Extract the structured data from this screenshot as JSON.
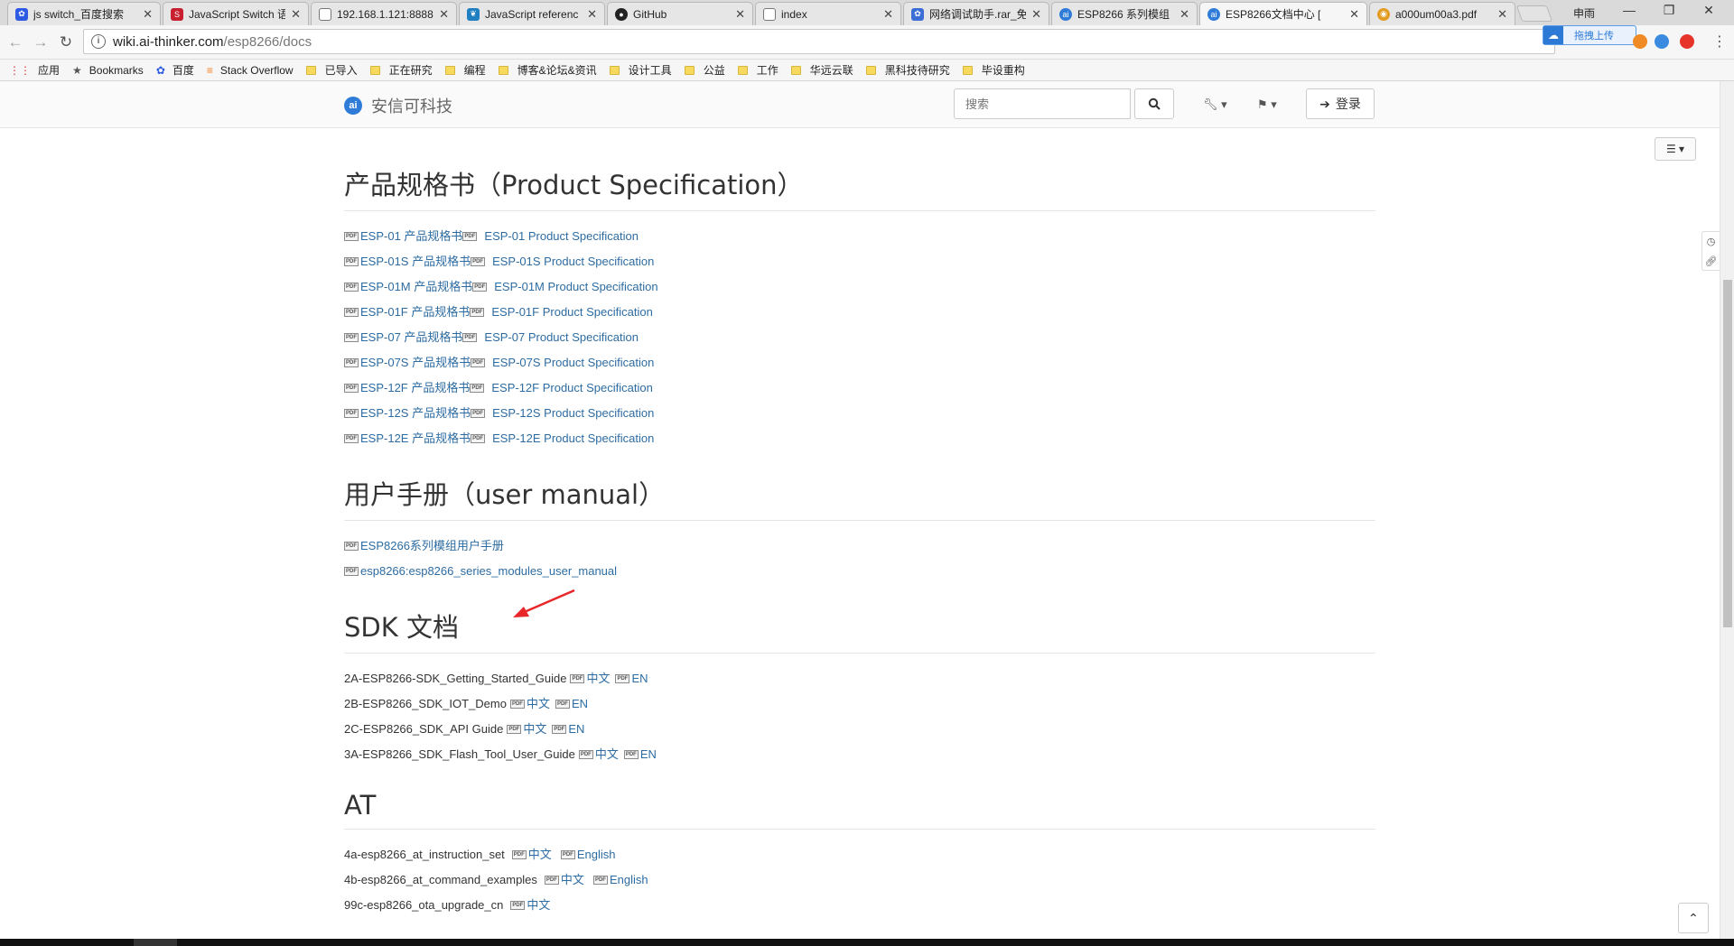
{
  "browser": {
    "tabs": [
      {
        "title": "js switch_百度搜索",
        "color": "#2d5be3",
        "glyph": "✿"
      },
      {
        "title": "JavaScript Switch 语",
        "color": "#c8202f",
        "glyph": "S"
      },
      {
        "title": "192.168.1.121:8888",
        "color": "#ffffff",
        "glyph": ""
      },
      {
        "title": "JavaScript referenc",
        "color": "#1f7fc0",
        "glyph": "❦"
      },
      {
        "title": "GitHub",
        "color": "#222222",
        "glyph": "●"
      },
      {
        "title": "index",
        "color": "#ffffff",
        "glyph": ""
      },
      {
        "title": "网络调试助手.rar_免",
        "color": "#3b6fd6",
        "glyph": "✿"
      },
      {
        "title": "ESP8266 系列模组",
        "color": "#2f7bd8",
        "glyph": "ai"
      },
      {
        "title": "ESP8266文档中心 [",
        "color": "#2f7bd8",
        "glyph": "ai"
      },
      {
        "title": "a000um00a3.pdf",
        "color": "#e49b22",
        "glyph": "◉"
      }
    ],
    "profile_label": "申雨",
    "url_host": "wiki.ai-thinker.com",
    "url_path": "/esp8266/docs",
    "upload_label": "拖拽上传",
    "bookmarks": [
      {
        "label": "应用",
        "kind": "apps"
      },
      {
        "label": "Bookmarks",
        "kind": "star"
      },
      {
        "label": "百度",
        "kind": "baidu"
      },
      {
        "label": "Stack Overflow",
        "kind": "so"
      },
      {
        "label": "已导入",
        "kind": "folder"
      },
      {
        "label": "正在研究",
        "kind": "folder"
      },
      {
        "label": "编程",
        "kind": "folder"
      },
      {
        "label": "博客&论坛&资讯",
        "kind": "folder"
      },
      {
        "label": "设计工具",
        "kind": "folder"
      },
      {
        "label": "公益",
        "kind": "folder"
      },
      {
        "label": "工作",
        "kind": "folder"
      },
      {
        "label": "华远云联",
        "kind": "folder"
      },
      {
        "label": "黑科技待研究",
        "kind": "folder"
      },
      {
        "label": "毕设重构",
        "kind": "folder"
      }
    ]
  },
  "site": {
    "logo_text": "安信可科技",
    "search_placeholder": "搜索",
    "login_label": "登录"
  },
  "sections": {
    "spec": {
      "heading": "产品规格书（Product Specification）",
      "items": [
        {
          "cn": "ESP-01 产品规格书",
          "en": "ESP-01 Product Specification"
        },
        {
          "cn": "ESP-01S 产品规格书",
          "en": "ESP-01S Product Specification"
        },
        {
          "cn": "ESP-01M 产品规格书",
          "en": "ESP-01M Product Specification"
        },
        {
          "cn": "ESP-01F 产品规格书",
          "en": "ESP-01F Product Specification"
        },
        {
          "cn": "ESP-07 产品规格书",
          "en": "ESP-07 Product Specification"
        },
        {
          "cn": "ESP-07S 产品规格书",
          "en": "ESP-07S Product Specification"
        },
        {
          "cn": "ESP-12F 产品规格书",
          "en": "ESP-12F Product Specification"
        },
        {
          "cn": "ESP-12S 产品规格书",
          "en": "ESP-12S Product Specification"
        },
        {
          "cn": "ESP-12E 产品规格书",
          "en": "ESP-12E Product Specification"
        }
      ]
    },
    "manual": {
      "heading": "用户手册（user manual）",
      "items": [
        "ESP8266系列模组用户手册",
        "esp8266:esp8266_series_modules_user_manual"
      ]
    },
    "sdk": {
      "heading": "SDK 文档",
      "items": [
        {
          "name": "2A-ESP8266-SDK_Getting_Started_Guide",
          "cn": "中文",
          "en": "EN"
        },
        {
          "name": "2B-ESP8266_SDK_IOT_Demo",
          "cn": "中文",
          "en": "EN"
        },
        {
          "name": "2C-ESP8266_SDK_API Guide",
          "cn": "中文",
          "en": "EN"
        },
        {
          "name": "3A-ESP8266_SDK_Flash_Tool_User_Guide",
          "cn": "中文",
          "en": "EN"
        }
      ]
    },
    "at": {
      "heading": "AT",
      "items": [
        {
          "name": "4a-esp8266_at_instruction_set",
          "cn": "中文",
          "en": "English"
        },
        {
          "name": "4b-esp8266_at_command_examples",
          "cn": "中文",
          "en": "English"
        },
        {
          "name": "99c-esp8266_ota_upgrade_cn",
          "cn": "中文",
          "en": ""
        }
      ]
    }
  },
  "pdf_icon_label": "PDF"
}
